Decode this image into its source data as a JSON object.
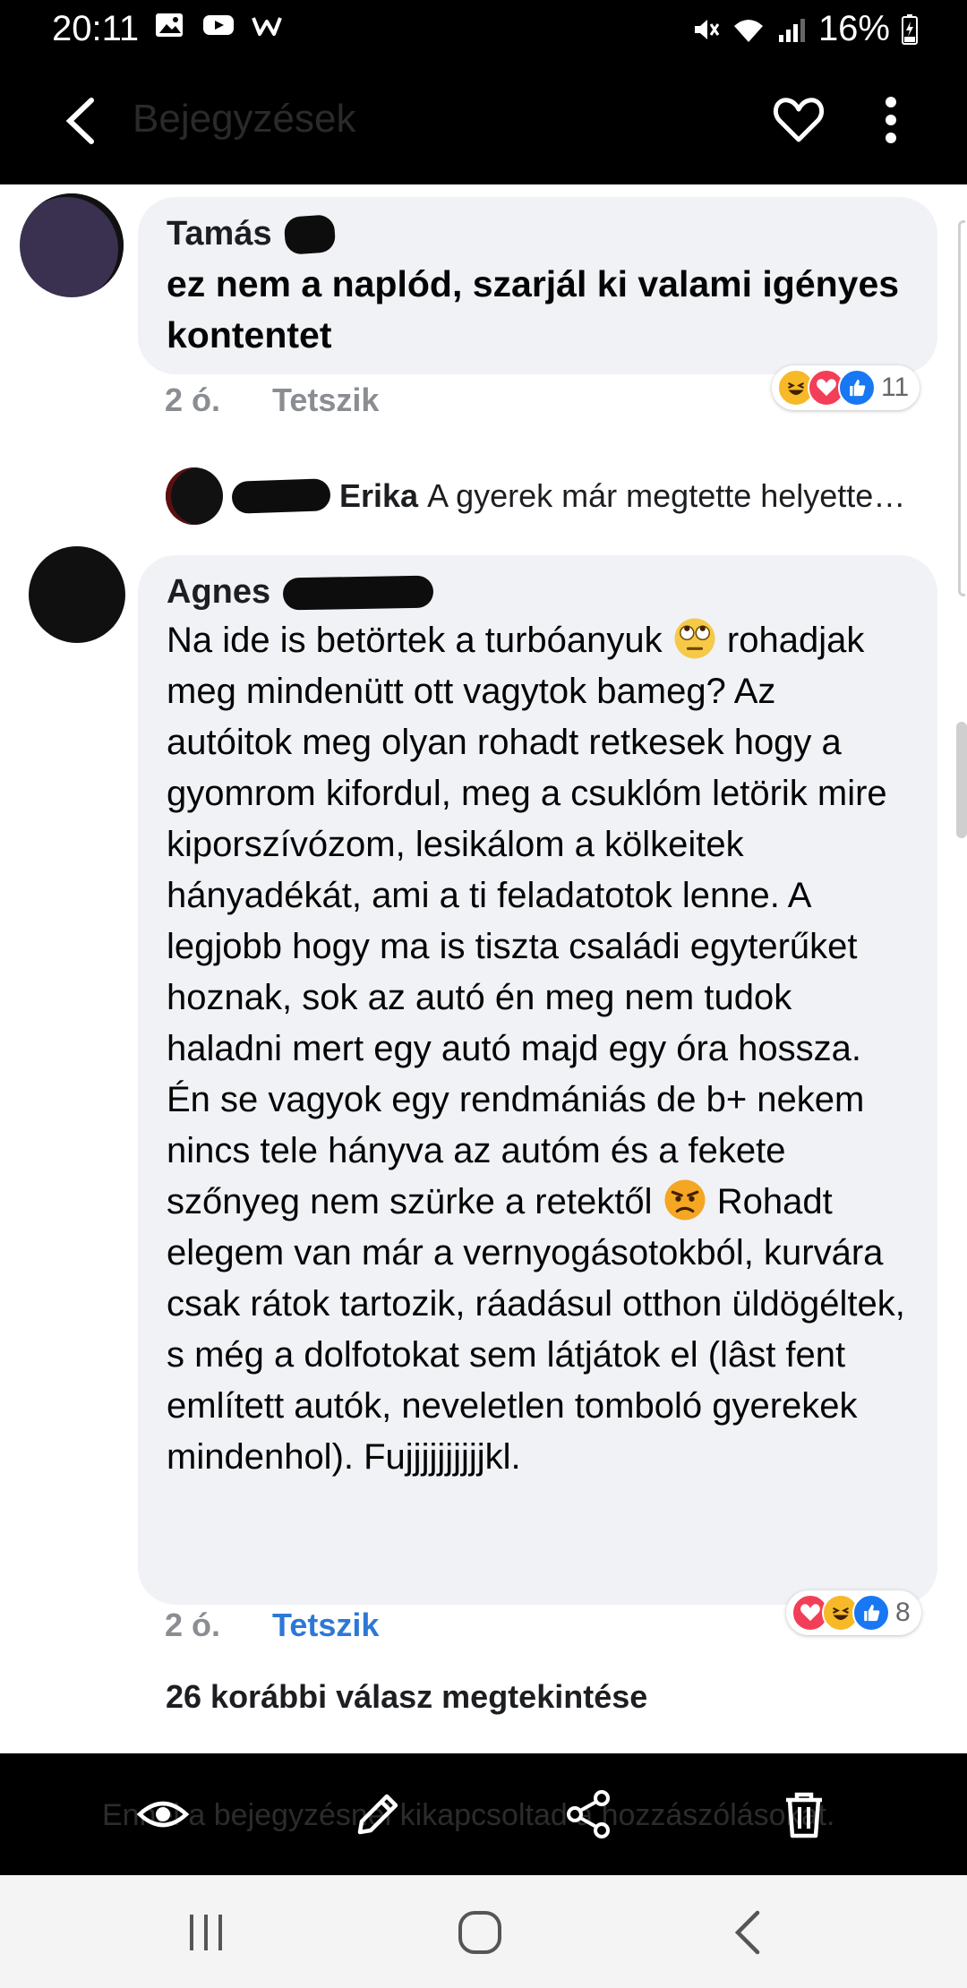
{
  "status_bar": {
    "time": "20:11",
    "battery": "16%"
  },
  "app_bar": {
    "title": "Bejegyzések"
  },
  "comments": [
    {
      "author": "Tamás",
      "text": "ez nem a naplód, szarjál ki valami igényes kontentet",
      "time": "2 ó.",
      "like_label": "Tetszik",
      "reaction_count": "11",
      "reactions": [
        "haha",
        "love",
        "like"
      ]
    },
    {
      "author": "Agnes",
      "text_lines": [
        "Na ide is betörtek a turbóanyuk",
        "rohadjak meg mindenütt ott vagytok bameg? Az autóitok meg olyan rohadt retkesek hogy a gyomrom kifordul, meg a csuklóm letörik mire kiporszívózom, lesikálom a kölkeitek hányadékát, ami a ti feladatotok lenne. A legjobb hogy ma is tiszta családi egyterűket hoznak, sok az autó én meg nem tudok haladni mert egy autó majd egy óra hossza. Én se vagyok egy rendmániás de b+ nekem nincs tele hányva az autóm és a fekete szőnyeg nem szürke a retektől",
        "Rohadt elegem van már a vernyogásotokból, kurvára csak rátok tartozik, ráadásul otthon üldögéltek, s még a dolfotokat sem látjátok el (lâst fent említett autók, neveletlen tomboló gyerekek mindenhol). Fujjjjjjjjjjkl."
      ],
      "time": "2 ó.",
      "like_label": "Tetszik",
      "reaction_count": "8",
      "reactions": [
        "love",
        "haha",
        "like"
      ]
    }
  ],
  "reply_preview": {
    "name": "Erika",
    "text": "A gyerek már megtette helyette…"
  },
  "more_replies": "26 korábbi válasz megtekintése",
  "bottom_notice": "Ennél a bejegyzésnél kikapcsoltad a hozzászólásokat.",
  "colors": {
    "accent": "#2d78d6",
    "bubble": "#f0f2f5",
    "bar": "#000000"
  },
  "icons": {
    "status_left": [
      "image-icon",
      "youtube-icon",
      "w-icon"
    ],
    "status_right": [
      "mute-icon",
      "wifi-icon",
      "signal-icon",
      "battery-icon"
    ],
    "actions": [
      "eye-icon",
      "pencil-icon",
      "share-icon",
      "trash-icon"
    ],
    "nav": [
      "recent-apps-icon",
      "home-icon",
      "back-icon"
    ]
  }
}
